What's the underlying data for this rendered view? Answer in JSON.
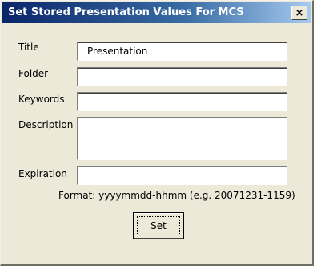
{
  "window": {
    "title": "Set Stored Presentation Values For MCS",
    "close_glyph": "×"
  },
  "form": {
    "title_label": "Title",
    "title_value": "Presentation",
    "folder_label": "Folder",
    "folder_value": "",
    "keywords_label": "Keywords",
    "keywords_value": "",
    "description_label": "Description",
    "description_value": "",
    "expiration_label": "Expiration",
    "expiration_value": "",
    "format_note": "Format: yyyymmdd-hhmm (e.g. 20071231-1159)",
    "set_label": "Set"
  },
  "icons": {
    "close": "close-icon"
  }
}
